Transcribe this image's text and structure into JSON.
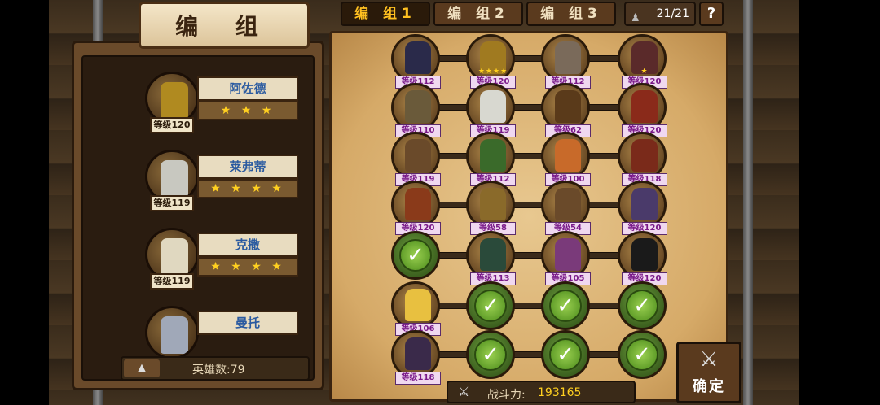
{
  "title": "编  组",
  "tabs": [
    {
      "label": "编 组1",
      "active": true
    },
    {
      "label": "编 组2",
      "active": false
    },
    {
      "label": "编 组3",
      "active": false
    }
  ],
  "team_count": "21/21",
  "help_label": "?",
  "heroes": [
    {
      "name": "阿佐德",
      "level": "等级120",
      "stars": "★ ★ ★",
      "color": "#b08a20"
    },
    {
      "name": "莱弗蒂",
      "level": "等级119",
      "stars": "★ ★ ★ ★",
      "color": "#c8c8c0"
    },
    {
      "name": "克撒",
      "level": "等级119",
      "stars": "★ ★ ★ ★",
      "color": "#e0d8c0"
    },
    {
      "name": "曼托",
      "level": "",
      "stars": "",
      "color": "#a0a8b8"
    }
  ],
  "hero_count": "英雄数:79",
  "formation": [
    [
      {
        "level": "等级112",
        "stars": "",
        "color": "#2a2a4a"
      },
      {
        "level": "等级120",
        "stars": "★★★★",
        "color": "#a07a20"
      },
      {
        "level": "等级112",
        "stars": "",
        "color": "#7a6a5a"
      },
      {
        "level": "等级120",
        "stars": "★",
        "color": "#5a2a2a"
      }
    ],
    [
      {
        "level": "等级110",
        "stars": "",
        "color": "#6a5a3a"
      },
      {
        "level": "等级119",
        "stars": "",
        "color": "#d8d8d0"
      },
      {
        "level": "等级62",
        "stars": "",
        "color": "#5a3a1a"
      },
      {
        "level": "等级120",
        "stars": "",
        "color": "#8a2a1a"
      }
    ],
    [
      {
        "level": "等级119",
        "stars": "",
        "color": "#6a4a2a"
      },
      {
        "level": "等级112",
        "stars": "",
        "color": "#3a6a2a"
      },
      {
        "level": "等级100",
        "stars": "",
        "color": "#c86a2a"
      },
      {
        "level": "等级118",
        "stars": "",
        "color": "#7a2a1a"
      }
    ],
    [
      {
        "level": "等级120",
        "stars": "",
        "color": "#8a3a1a"
      },
      {
        "level": "等级58",
        "stars": "",
        "color": "#8a6a2a"
      },
      {
        "level": "等级54",
        "stars": "",
        "color": "#6a4a2a"
      },
      {
        "level": "等级120",
        "stars": "",
        "color": "#4a3a6a"
      }
    ],
    [
      null,
      {
        "level": "等级113",
        "stars": "",
        "color": "#2a4a3a"
      },
      {
        "level": "等级105",
        "stars": "",
        "color": "#7a3a7a"
      },
      {
        "level": "等级120",
        "stars": "",
        "color": "#1a1a1a"
      }
    ],
    [
      {
        "level": "等级106",
        "stars": "",
        "color": "#e8c040"
      },
      null,
      null,
      null
    ],
    [
      {
        "level": "等级118",
        "stars": "",
        "color": "#3a2a4a"
      },
      null,
      null,
      null
    ]
  ],
  "power_label": "战斗力:",
  "power_value": "193165",
  "confirm_label": "确定",
  "accent_color": "#ffc020"
}
